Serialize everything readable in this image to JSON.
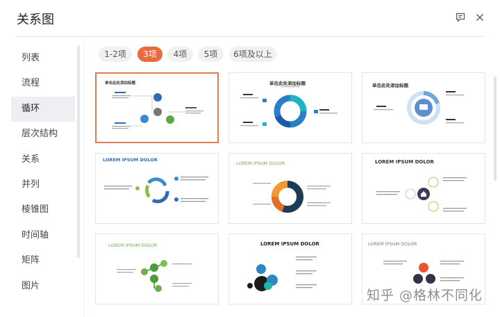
{
  "dialog": {
    "title": "关系图"
  },
  "header": {
    "feedback_icon": "comment-icon",
    "close_icon": "close-icon"
  },
  "sidebar": {
    "items": [
      "列表",
      "流程",
      "循环",
      "层次结构",
      "关系",
      "并列",
      "棱锥图",
      "时间轴",
      "矩阵",
      "图片"
    ],
    "active_index": 2
  },
  "tabs": {
    "items": [
      "1-2项",
      "3项",
      "4项",
      "5项",
      "6项及以上"
    ],
    "active_index": 1
  },
  "templates": {
    "title_cn": "单击此处添加标题",
    "title_en": "LOREM IPSUM DOLOR",
    "title_cn_small": "单击此处添加标题"
  },
  "colors": {
    "accent": "#e96a3f",
    "active_bg": "#eeeff2"
  },
  "watermark": "知乎 @格林不同化"
}
